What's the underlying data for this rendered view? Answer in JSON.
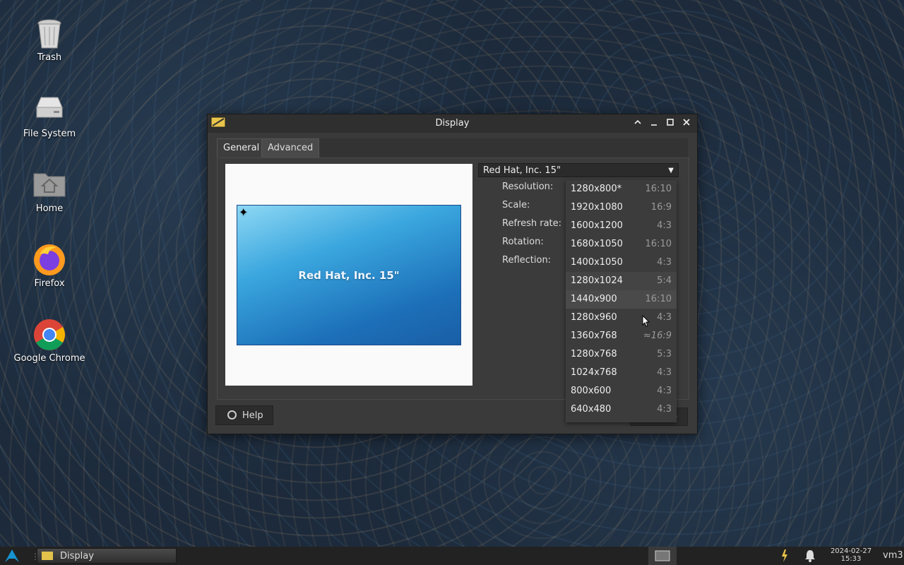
{
  "desktop": {
    "icons": [
      {
        "label": "Trash",
        "icon": "trash-icon"
      },
      {
        "label": "File System",
        "icon": "drive-icon"
      },
      {
        "label": "Home",
        "icon": "home-folder-icon"
      },
      {
        "label": "Firefox",
        "icon": "firefox-icon"
      },
      {
        "label": "Google Chrome",
        "icon": "chrome-icon"
      }
    ]
  },
  "window": {
    "title": "Display",
    "tabs": [
      {
        "label": "General"
      },
      {
        "label": "Advanced"
      }
    ],
    "active_tab": "General",
    "preview_label": "Red Hat, Inc. 15\"",
    "display_select": "Red Hat, Inc. 15\"",
    "fields": {
      "resolution": "Resolution:",
      "scale": "Scale:",
      "refresh_rate": "Refresh rate:",
      "rotation": "Rotation:",
      "reflection": "Reflection:"
    },
    "help_label": "Help",
    "close_label": "Close",
    "close_visible_fragment": "e"
  },
  "resolution_dropdown": {
    "options": [
      {
        "res": "1280x800*",
        "ratio": "16:10"
      },
      {
        "res": "1920x1080",
        "ratio": "16:9"
      },
      {
        "res": "1600x1200",
        "ratio": "4:3"
      },
      {
        "res": "1680x1050",
        "ratio": "16:10"
      },
      {
        "res": "1400x1050",
        "ratio": "4:3"
      },
      {
        "res": "1280x1024",
        "ratio": "5:4"
      },
      {
        "res": "1440x900",
        "ratio": "16:10"
      },
      {
        "res": "1280x960",
        "ratio": "4:3"
      },
      {
        "res": "1360x768",
        "ratio": "≈16:9"
      },
      {
        "res": "1280x768",
        "ratio": "5:3"
      },
      {
        "res": "1024x768",
        "ratio": "4:3"
      },
      {
        "res": "800x600",
        "ratio": "4:3"
      },
      {
        "res": "640x480",
        "ratio": "4:3"
      }
    ],
    "hovered": "1440x900"
  },
  "taskbar": {
    "task_label": "Display",
    "date": "2024-02-27",
    "time": "15:33",
    "user": "vm3"
  }
}
